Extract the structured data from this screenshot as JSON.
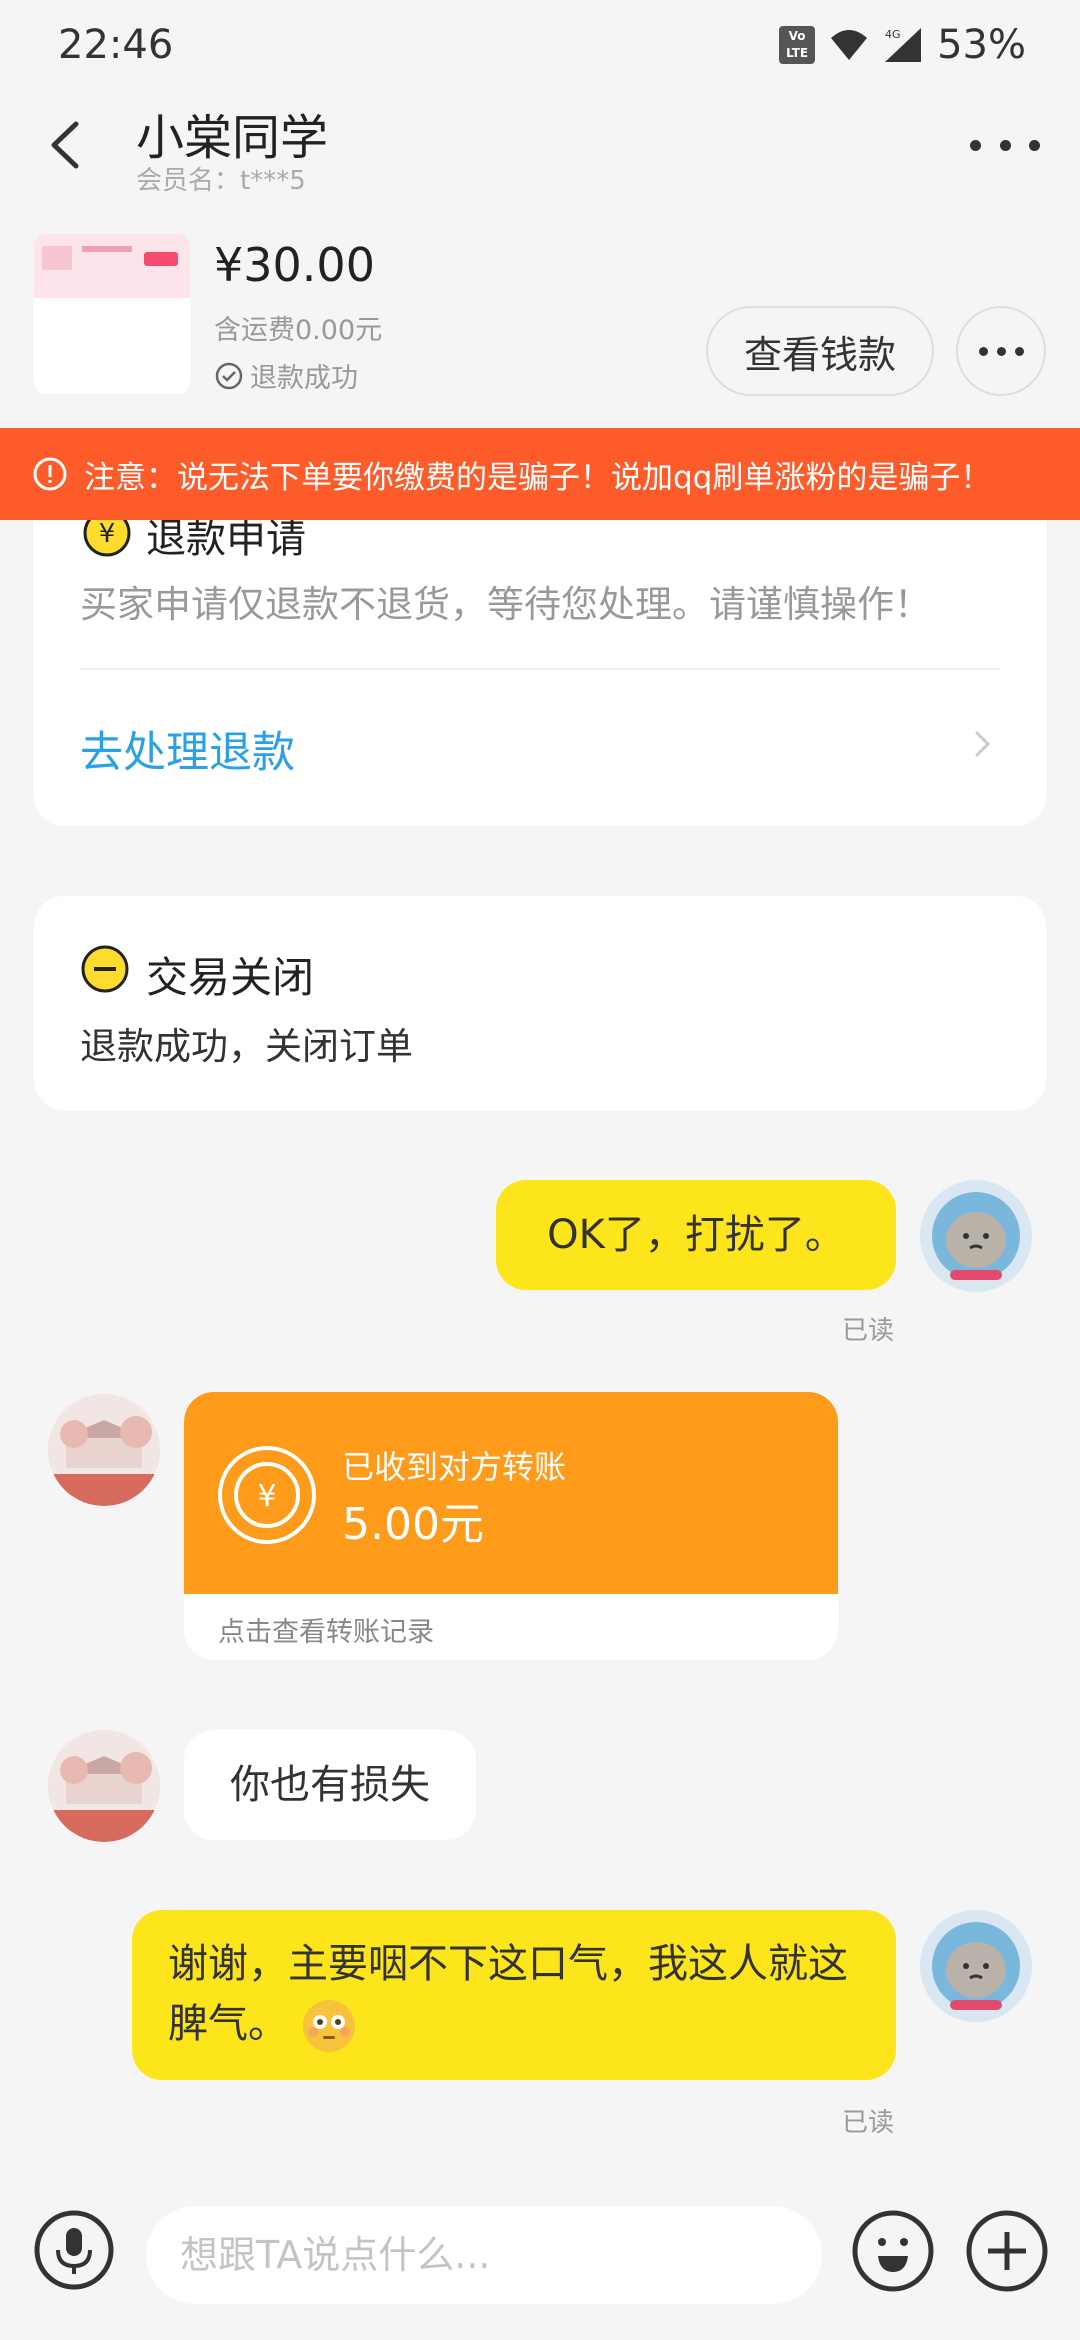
{
  "status_bar": {
    "time": "22:46",
    "signal": "4G",
    "battery": "53%",
    "volte": "VoLTE"
  },
  "header": {
    "title": "小棠同学",
    "member": "会员名：t***5"
  },
  "order": {
    "price": "¥30.00",
    "shipping": "含运费0.00元",
    "status": "退款成功",
    "view_button": "查看钱款"
  },
  "warning": "注意：说无法下单要你缴费的是骗子！说加qq刷单涨粉的是骗子！",
  "refund_card": {
    "title": "退款申请",
    "desc": "买家申请仅退款不退货，等待您处理。请谨慎操作！",
    "link": "去处理退款"
  },
  "closed_card": {
    "title": "交易关闭",
    "desc": "退款成功，关闭订单"
  },
  "messages": {
    "m1": {
      "text": "OK了，打扰了。",
      "read": "已读"
    },
    "transfer": {
      "label": "已收到对方转账",
      "amount": "5.00元",
      "footer": "点击查看转账记录"
    },
    "m3": {
      "text": "你也有损失"
    },
    "m4": {
      "text": "谢谢，主要咽不下这口气，我这人就这脾气。",
      "read": "已读"
    }
  },
  "input": {
    "placeholder": "想跟TA说点什么..."
  },
  "colors": {
    "warning": "#fe5b2b",
    "my_bubble": "#fde51b",
    "transfer": "#fe9b1a",
    "link": "#2aa1e6"
  }
}
